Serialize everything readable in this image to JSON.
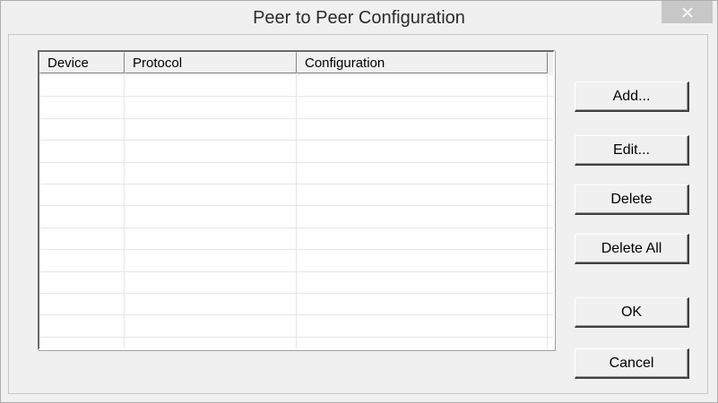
{
  "window": {
    "title": "Peer to Peer Configuration",
    "close_icon": "close-icon"
  },
  "table": {
    "columns": [
      "Device",
      "Protocol",
      "Configuration"
    ],
    "rows": []
  },
  "buttons": {
    "add": "Add...",
    "edit": "Edit...",
    "delete": "Delete",
    "delete_all": "Delete All",
    "ok": "OK",
    "cancel": "Cancel"
  }
}
